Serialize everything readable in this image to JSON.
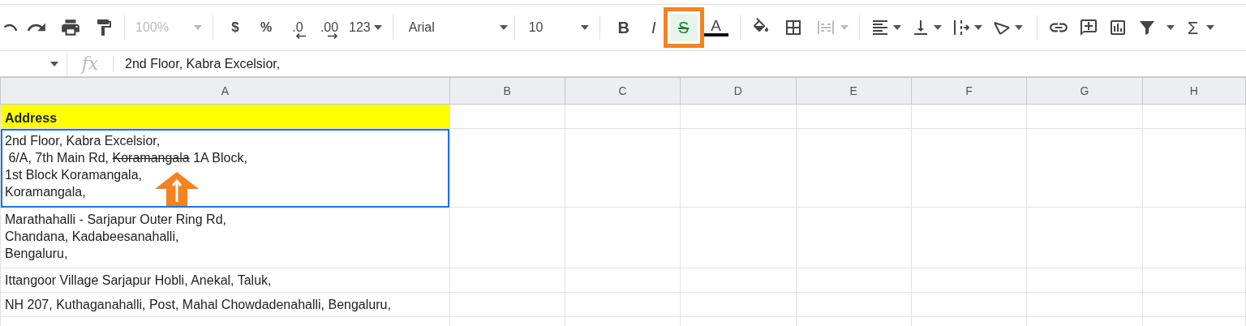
{
  "toolbar": {
    "zoom": {
      "label": "100%",
      "disabled": true
    },
    "currency": "$",
    "percent": "%",
    "decrease_decimal": ".0",
    "increase_decimal": ".00",
    "number_format": "123",
    "font": "Arial",
    "font_size": "10",
    "format_buttons": [
      {
        "kind": "bold",
        "label": "B",
        "selected": false,
        "highlighted": false
      },
      {
        "kind": "italic",
        "label": "I",
        "selected": false,
        "highlighted": false
      },
      {
        "kind": "strikethrough",
        "label": "S",
        "selected": true,
        "highlighted": true
      },
      {
        "kind": "text_color",
        "label": "A",
        "selected": false,
        "highlighted": false
      }
    ],
    "merge_cells": {
      "disabled": true
    },
    "functions": "Σ"
  },
  "formula_bar": {
    "fx": "fx",
    "value": "2nd Floor, Kabra Excelsior,"
  },
  "sheet": {
    "columns": [
      "A",
      "B",
      "C",
      "D",
      "E",
      "F",
      "G",
      "H"
    ],
    "rows": [
      {
        "selected": false,
        "header": true,
        "lines": [
          [
            {
              "text": "Address",
              "struck": false
            }
          ]
        ]
      },
      {
        "selected": true,
        "header": false,
        "lines": [
          [
            {
              "text": "2nd Floor, Kabra Excelsior,",
              "struck": false
            }
          ],
          [
            {
              "text": " 6/A, 7th Main Rd, ",
              "struck": false
            },
            {
              "text": "Koramangala",
              "struck": true
            },
            {
              "text": " 1A Block,",
              "struck": false
            }
          ],
          [
            {
              "text": "1st Block Koramangala,",
              "struck": false
            }
          ],
          [
            {
              "text": "Koramangala,",
              "struck": false
            }
          ]
        ]
      },
      {
        "selected": false,
        "header": false,
        "lines": [
          [
            {
              "text": "Marathahalli - Sarjapur Outer Ring Rd,",
              "struck": false
            }
          ],
          [
            {
              "text": "Chandana, Kadabeesanahalli,",
              "struck": false
            }
          ],
          [
            {
              "text": "Bengaluru,",
              "struck": false
            }
          ]
        ]
      },
      {
        "selected": false,
        "header": false,
        "lines": [
          [
            {
              "text": "Ittangoor Village Sarjapur Hobli, Anekal, Taluk,",
              "struck": false
            }
          ]
        ]
      },
      {
        "selected": false,
        "header": false,
        "lines": [
          [
            {
              "text": "NH 207, Kuthaganahalli, Post, Mahal Chowdadenahalli, Bengaluru,",
              "struck": false
            }
          ]
        ]
      }
    ]
  },
  "annotation": {
    "kind": "arrow"
  }
}
